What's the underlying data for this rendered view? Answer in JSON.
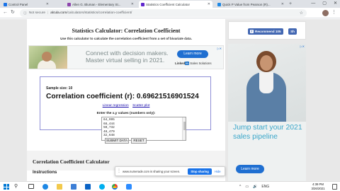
{
  "browser": {
    "tabs": [
      {
        "label": "Control Panel",
        "active": false,
        "color": "#1a73e8"
      },
      {
        "label": "Allen G. Bluman - Elementary St...",
        "active": false,
        "color": "#8e44ad"
      },
      {
        "label": "Statistics Coefficient Calculator",
        "active": true,
        "color": "#5f27cd"
      },
      {
        "label": "Quick P Value from Pearson (R)...",
        "active": false,
        "color": "#1e88e5"
      }
    ],
    "new_tab_glyph": "+",
    "window_controls": [
      "—",
      "▢",
      "✕"
    ],
    "address": {
      "security_label": "Not secure",
      "domain": "alcula.com",
      "path": "/calculators/statistics/correlation-coefficient/"
    }
  },
  "page": {
    "title": "Statistics Calculator: Correlation Coefficient",
    "subtitle": "Use this calculator to calculate the correlation coefficient from a set of bivariate data.",
    "banner_ad": {
      "headline_line1": "Connect with decision makers.",
      "headline_line2": "Master virtual selling in 2021.",
      "cta": "Learn more",
      "brand_prefix": "Linked",
      "brand_badge": "in",
      "brand_suffix": " Sales Solutions"
    },
    "result": {
      "sample_size_label": "Sample size: 10",
      "correlation_text": "Correlation coefficient (r):  0.69621516901524",
      "links": [
        "Linear regression",
        "Scatter plot"
      ]
    },
    "input": {
      "label": "Enter the x,y values (numbers only):",
      "values": [
        "64,995",
        "68,444",
        "50,732",
        "48,479",
        "32,648"
      ]
    },
    "buttons": {
      "submit": "SUBMIT DATA",
      "reset": "RESET"
    },
    "section_title": "Correlation Coefficient Calculator",
    "instructions_heading": "Instructions"
  },
  "sidebar": {
    "recommend_label": "Recommend 105",
    "share_label": "Sh",
    "ad": {
      "headline": "Jump start your 2021 sales pipeline",
      "cta": "Learn more"
    }
  },
  "share_notice": {
    "message": "www.numerade.com is sharing your screen.",
    "stop_label": "Stop sharing",
    "hide_label": "Hide"
  },
  "taskbar": {
    "time": "4:39 PM",
    "date": "3/26/2021",
    "tray": [
      "^",
      "▭",
      "🔊",
      "ENG"
    ]
  }
}
